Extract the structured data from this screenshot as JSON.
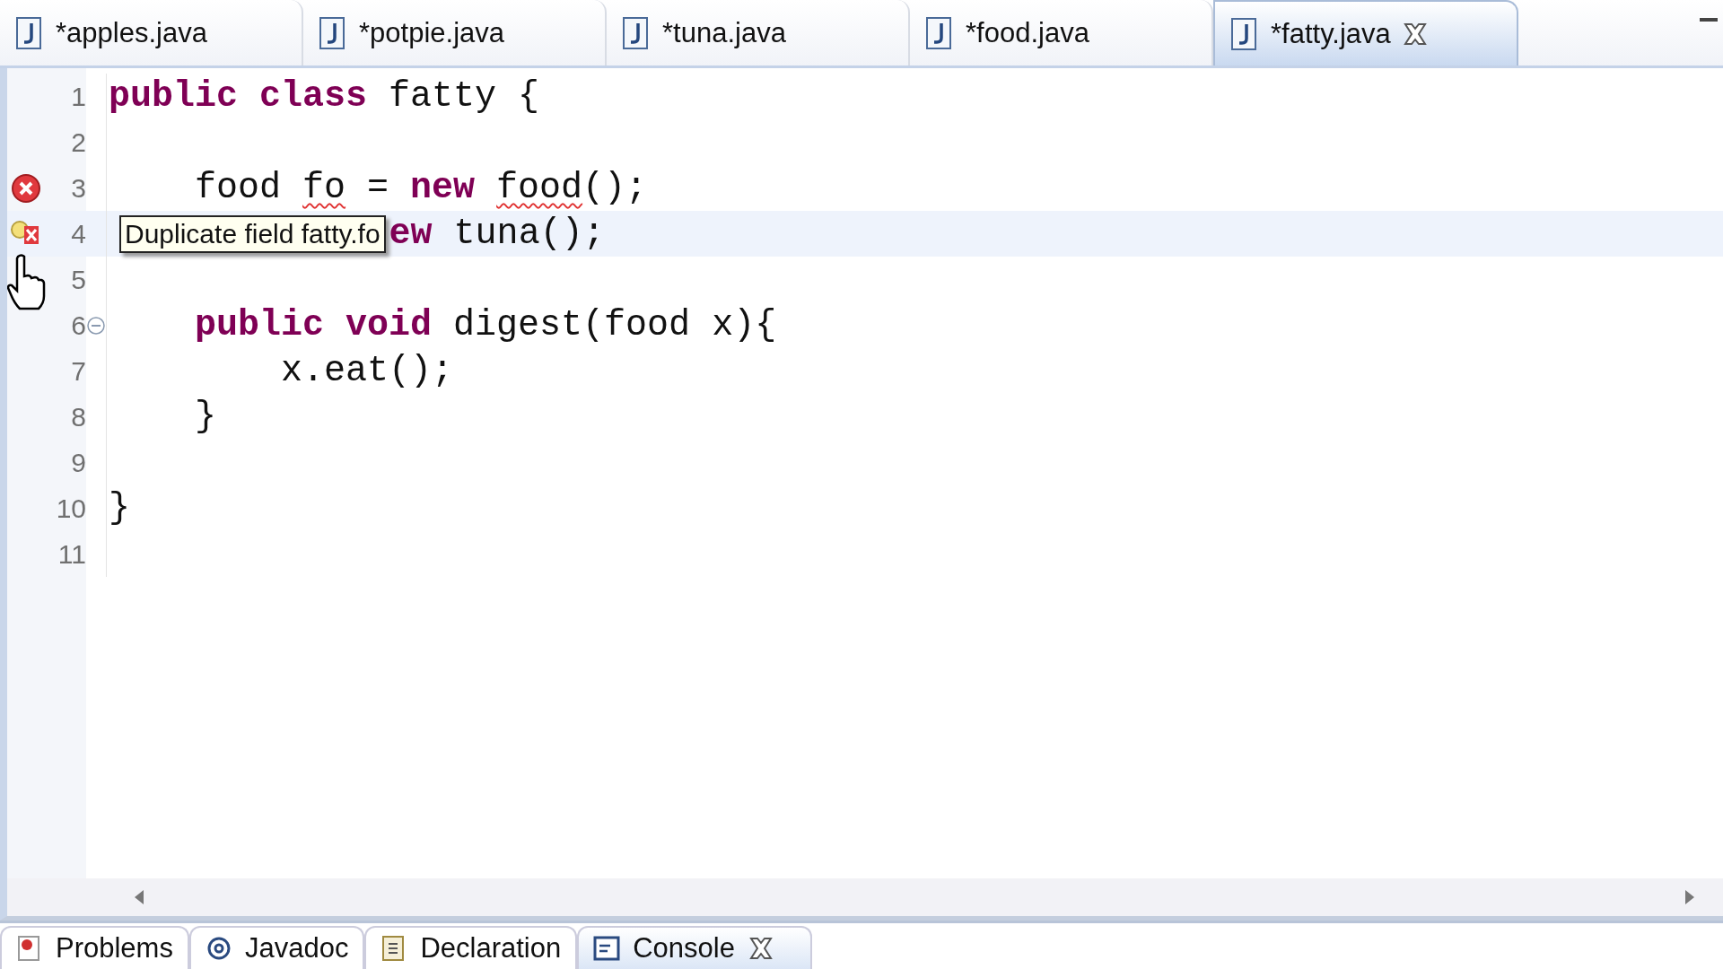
{
  "editor_tabs": [
    {
      "label": "*apples.java",
      "selected": false
    },
    {
      "label": "*potpie.java",
      "selected": false
    },
    {
      "label": "*tuna.java",
      "selected": false
    },
    {
      "label": "*food.java",
      "selected": false
    },
    {
      "label": "*fatty.java",
      "selected": true
    }
  ],
  "lines": [
    {
      "number": "1",
      "error": false,
      "quick_fix": false,
      "current": false,
      "fold": false,
      "tokens": [
        {
          "text": "public ",
          "kind": "keyword"
        },
        {
          "text": "class ",
          "kind": "keyword"
        },
        {
          "text": "fatty {",
          "kind": "plain"
        }
      ]
    },
    {
      "number": "2",
      "error": false,
      "quick_fix": false,
      "current": false,
      "fold": false
    },
    {
      "number": "3",
      "error": true,
      "quick_fix": false,
      "current": false,
      "fold": false,
      "tokens": [
        {
          "text": "    food ",
          "kind": "plain"
        },
        {
          "text": "fo",
          "kind": "error"
        },
        {
          "text": " = ",
          "kind": "plain"
        },
        {
          "text": "new ",
          "kind": "keyword"
        },
        {
          "text": "food",
          "kind": "error"
        },
        {
          "text": "();",
          "kind": "plain"
        }
      ]
    },
    {
      "number": "4",
      "error": true,
      "quick_fix": true,
      "current": true,
      "fold": false,
      "tooltip": "Duplicate field fatty.fo",
      "tokens": [
        {
          "text": "ew",
          "kind": "keyword"
        },
        {
          "text": " tuna();",
          "kind": "plain"
        }
      ]
    },
    {
      "number": "5",
      "error": false,
      "quick_fix": false,
      "current": false,
      "fold": false
    },
    {
      "number": "6",
      "error": false,
      "quick_fix": false,
      "current": false,
      "fold": true,
      "tokens": [
        {
          "text": "    public ",
          "kind": "keyword"
        },
        {
          "text": "void ",
          "kind": "keyword"
        },
        {
          "text": "digest(food x){",
          "kind": "plain"
        }
      ]
    },
    {
      "number": "7",
      "error": false,
      "quick_fix": false,
      "current": false,
      "fold": false,
      "tokens": [
        {
          "text": "        x.eat();",
          "kind": "plain"
        }
      ]
    },
    {
      "number": "8",
      "error": false,
      "quick_fix": false,
      "current": false,
      "fold": false,
      "tokens": [
        {
          "text": "    }",
          "kind": "plain"
        }
      ]
    },
    {
      "number": "9",
      "error": false,
      "quick_fix": false,
      "current": false,
      "fold": false
    },
    {
      "number": "10",
      "error": false,
      "quick_fix": false,
      "current": false,
      "fold": false,
      "tokens": [
        {
          "text": "}",
          "kind": "plain"
        }
      ]
    },
    {
      "number": "11",
      "error": false,
      "quick_fix": false,
      "current": false,
      "fold": false
    }
  ],
  "view_tabs": [
    {
      "label": "Problems",
      "selected": false
    },
    {
      "label": "Javadoc",
      "selected": false
    },
    {
      "label": "Declaration",
      "selected": false
    },
    {
      "label": "Console",
      "selected": true
    }
  ]
}
